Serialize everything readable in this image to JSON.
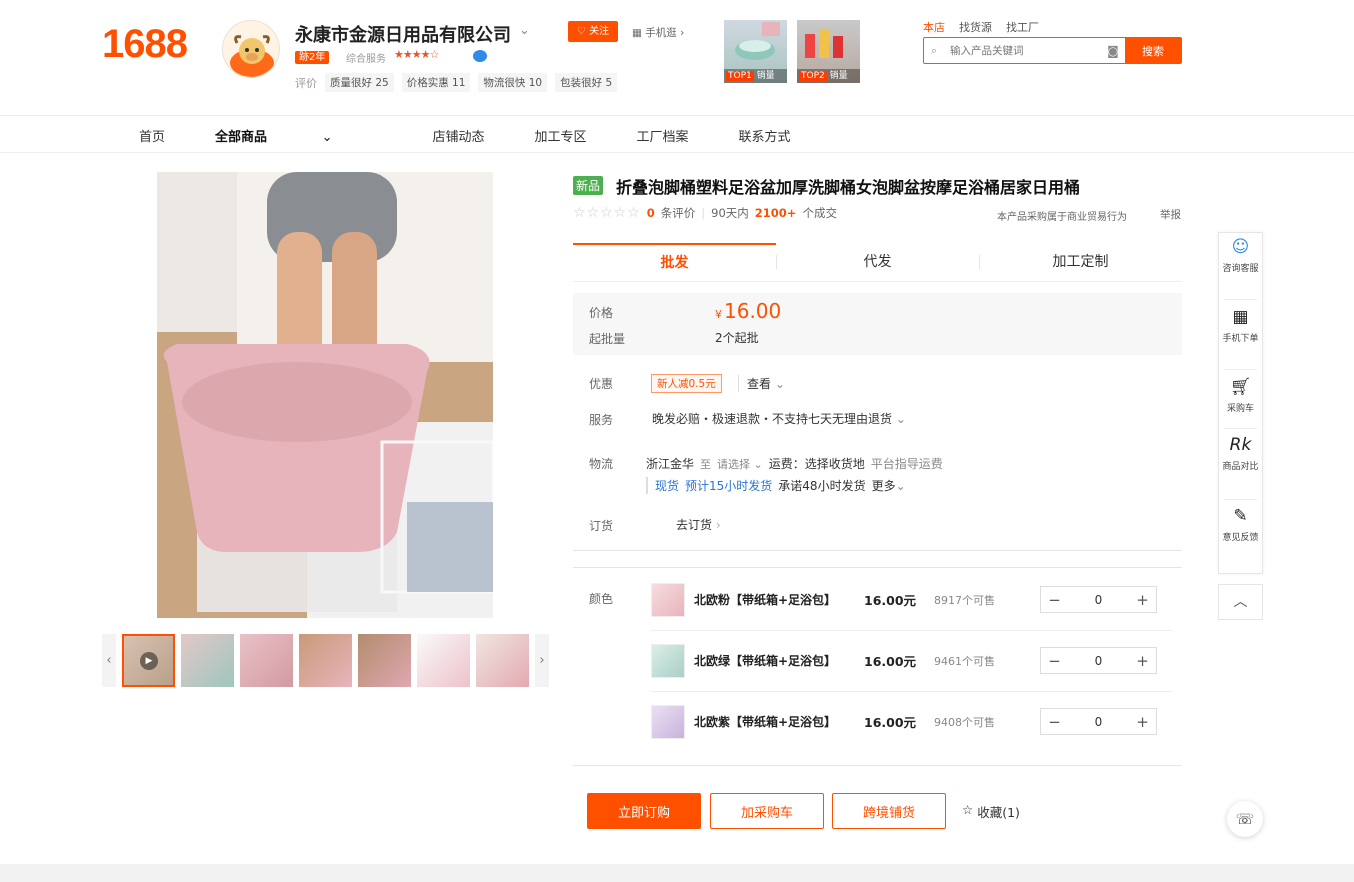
{
  "header": {
    "logo": "1688",
    "shop_name": "永康市金源日用品有限公司",
    "years_badge": "跡2年",
    "service_label": "综合服务",
    "stars": "★★★★☆",
    "eval_label": "评价",
    "eval_chips": [
      "质量很好 25",
      "价格实惠 11",
      "物流很快 10",
      "包装很好 5"
    ],
    "follow": "关注",
    "mobile": "手机逛",
    "top_items": [
      {
        "rank": "TOP1",
        "label": "销量"
      },
      {
        "rank": "TOP2",
        "label": "销量"
      }
    ],
    "search_tabs": [
      "本店",
      "找货源",
      "找工厂"
    ],
    "search_placeholder": "输入产品关键词",
    "search_button": "搜索"
  },
  "nav": [
    "首页",
    "全部商品",
    "店铺动态",
    "加工专区",
    "工厂档案",
    "联系方式"
  ],
  "product": {
    "badge": "新品",
    "title": "折叠泡脚桶塑料足浴盆加厚洗脚桶女泡脚盆按摩足浴桶居家日用桶",
    "review_count": "0",
    "review_suffix": "条评价",
    "period": "90天内",
    "deals": "2100+",
    "deals_suffix": "个成交",
    "biz_note": "本产品采购属于商业贸易行为",
    "report": "举报",
    "tabs": [
      "批发",
      "代发",
      "加工定制"
    ],
    "price_label": "价格",
    "currency": "¥",
    "price": "16.00",
    "moq_label": "起批量",
    "moq": "2个起批",
    "promo_label": "优惠",
    "promo_tag": "新人减0.5元",
    "promo_view": "查看",
    "service_label": "服务",
    "service": "晚发必赔・极速退款・不支持七天无理由退货",
    "logistics_label": "物流",
    "origin": "浙江金华",
    "to": "至",
    "choose": "请选择",
    "freight": "运费：选择收货地",
    "platform": "平台指导运费",
    "spot": "现货",
    "eta": "预计15小时发货",
    "promise": "承诺48小时发货",
    "more": "更多",
    "order_label": "订货",
    "order": "去订货",
    "color_label": "颜色",
    "skus": [
      {
        "name": "北欧粉【带纸箱+足浴包】",
        "price": "16.00元",
        "stock": "8917个可售",
        "qty": "0",
        "color": "#e8b4bc"
      },
      {
        "name": "北欧绿【带纸箱+足浴包】",
        "price": "16.00元",
        "stock": "9461个可售",
        "qty": "0",
        "color": "#a9cfc6"
      },
      {
        "name": "北欧紫【带纸箱+足浴包】",
        "price": "16.00元",
        "stock": "9408个可售",
        "qty": "0",
        "color": "#c9b3dc"
      }
    ],
    "buy_now": "立即订购",
    "add_cart": "加采购车",
    "cross_border": "跨境铺货",
    "favorite": "收藏(1)"
  },
  "sidebar": [
    {
      "label": "咨询客服",
      "icon": "chat-icon"
    },
    {
      "label": "手机下单",
      "icon": "qr-icon"
    },
    {
      "label": "采购车",
      "icon": "cart-icon"
    },
    {
      "label": "商品对比",
      "icon": "compare-icon"
    },
    {
      "label": "意见反馈",
      "icon": "edit-icon"
    }
  ],
  "colors": {
    "accent": "#ff5000",
    "new_badge": "#4caf50",
    "link": "#2b74d6"
  }
}
